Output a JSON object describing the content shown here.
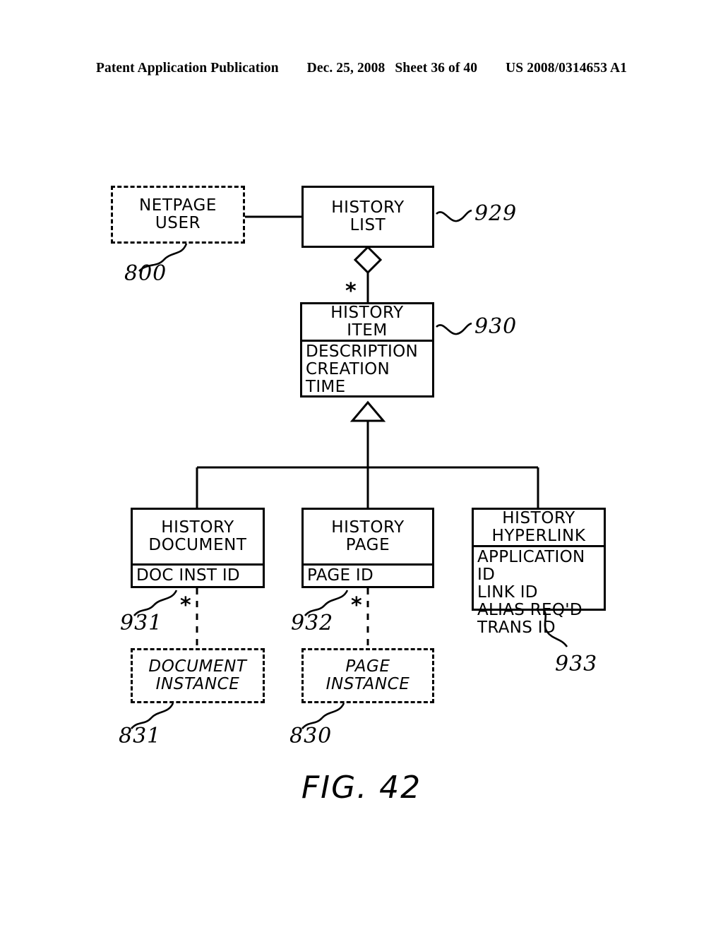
{
  "header": {
    "publication": "Patent Application Publication",
    "date": "Dec. 25, 2008",
    "sheet": "Sheet 36 of 40",
    "patent_number": "US 2008/0314653 A1"
  },
  "figure": {
    "caption": "FIG. 42"
  },
  "diagram": {
    "type": "uml-class-diagram",
    "boxes": [
      {
        "id": "netpage-user",
        "title": "NETPAGE\nUSER",
        "attributes": "",
        "style": "dashed",
        "ref": "800"
      },
      {
        "id": "history-list",
        "title": "HISTORY\nLIST",
        "attributes": "",
        "style": "solid",
        "ref": "929"
      },
      {
        "id": "history-item",
        "title": "HISTORY\nITEM",
        "attributes": "DESCRIPTION\nCREATION TIME",
        "style": "solid",
        "ref": "930"
      },
      {
        "id": "history-document",
        "title": "HISTORY\nDOCUMENT",
        "attributes": "DOC INST ID",
        "style": "solid",
        "ref": "931"
      },
      {
        "id": "history-page",
        "title": "HISTORY\nPAGE",
        "attributes": "PAGE ID",
        "style": "solid",
        "ref": "932"
      },
      {
        "id": "history-hyperlink",
        "title": "HISTORY\nHYPERLINK",
        "attributes": "APPLICATION ID\nLINK ID\nALIAS REQ'D\nTRANS ID",
        "style": "solid",
        "ref": "933"
      },
      {
        "id": "document-instance",
        "title": "DOCUMENT\nINSTANCE",
        "attributes": "",
        "style": "dashed-italic",
        "ref": "831"
      },
      {
        "id": "page-instance",
        "title": "PAGE\nINSTANCE",
        "attributes": "",
        "style": "dashed-italic",
        "ref": "830"
      }
    ],
    "multiplicities": [
      {
        "id": "item-star",
        "label": "*"
      },
      {
        "id": "document-star",
        "label": "*"
      },
      {
        "id": "page-star",
        "label": "*"
      }
    ],
    "reference_numerals": [
      "800",
      "929",
      "930",
      "931",
      "932",
      "933",
      "830",
      "831"
    ]
  },
  "colors": {
    "ink": "#000000",
    "paper": "#ffffff"
  }
}
